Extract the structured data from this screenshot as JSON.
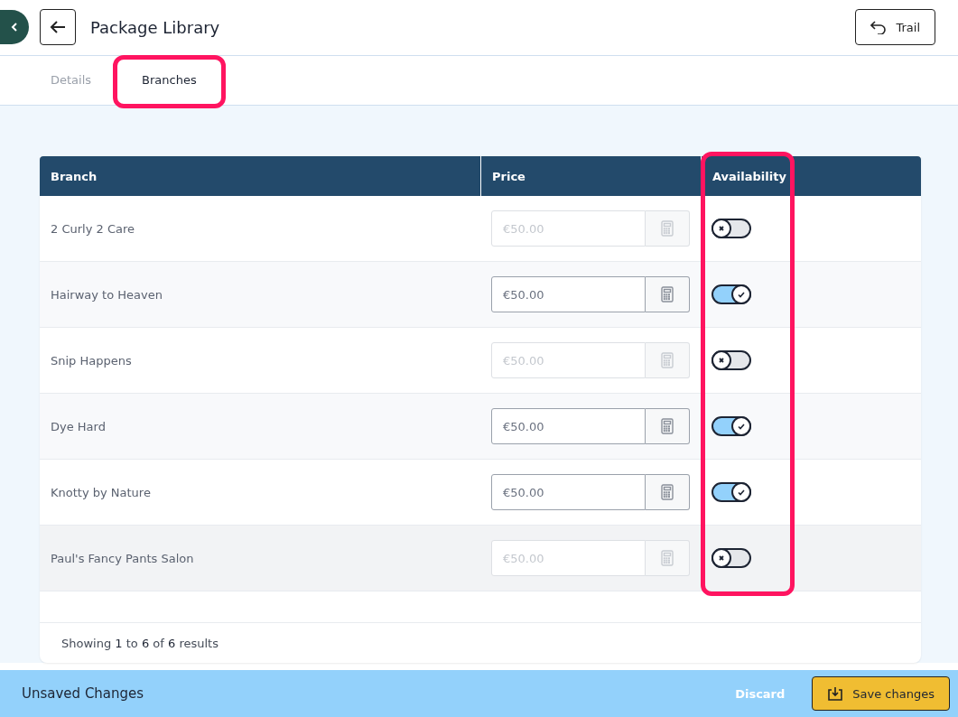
{
  "header": {
    "title": "Package Library",
    "trail_button": "Trail"
  },
  "tabs": [
    {
      "label": "Details",
      "selected": false
    },
    {
      "label": "Branches",
      "selected": true
    }
  ],
  "table": {
    "columns": [
      "Branch",
      "Price",
      "Availability"
    ],
    "rows": [
      {
        "branch": "2 Curly 2 Care",
        "price": "€50.00",
        "available": false
      },
      {
        "branch": "Hairway to Heaven",
        "price": "€50.00",
        "available": true
      },
      {
        "branch": "Snip Happens",
        "price": "€50.00",
        "available": false
      },
      {
        "branch": "Dye Hard",
        "price": "€50.00",
        "available": true
      },
      {
        "branch": "Knotty by Nature",
        "price": "€50.00",
        "available": true
      },
      {
        "branch": "Paul's Fancy Pants Salon",
        "price": "€50.00",
        "available": false
      }
    ],
    "footer": "Showing **1** to **6** of **6** results"
  },
  "save_bar": {
    "message": "Unsaved Changes",
    "discard": "Discard",
    "save": "Save changes"
  }
}
